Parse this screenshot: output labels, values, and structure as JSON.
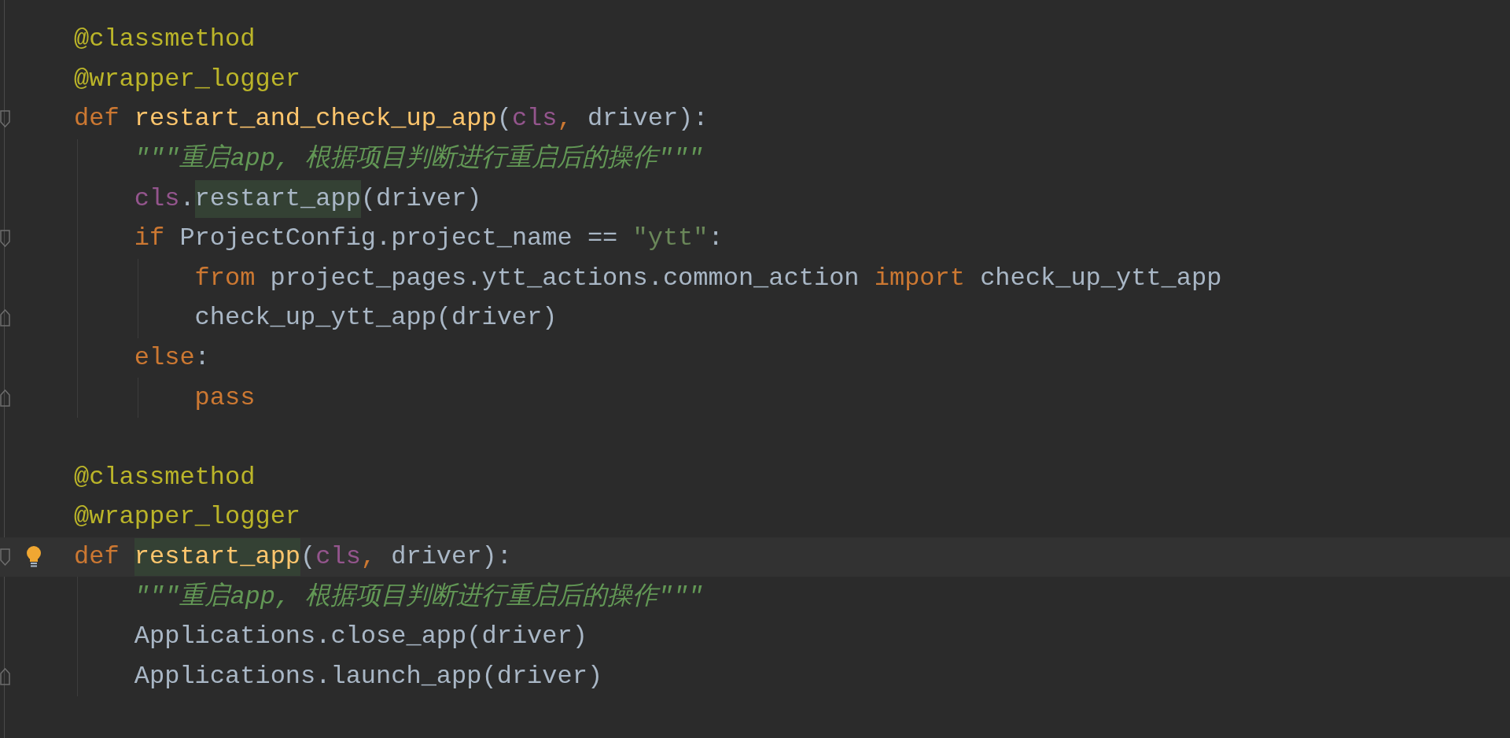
{
  "editor": {
    "lines": [
      {
        "current": false,
        "bulb": false,
        "fold_start": false,
        "fold_end": false,
        "tokens": [
          {
            "text": "@classmethod",
            "kind": "decorator",
            "highlighted": false
          }
        ]
      },
      {
        "current": false,
        "bulb": false,
        "fold_start": false,
        "fold_end": false,
        "tokens": [
          {
            "text": "@wrapper_logger",
            "kind": "decorator",
            "highlighted": false
          }
        ]
      },
      {
        "current": false,
        "bulb": false,
        "fold_start": true,
        "fold_end": false,
        "tokens": [
          {
            "text": "def",
            "kind": "keyword",
            "highlighted": false
          },
          {
            "text": "restart_and_check_up_app",
            "kind": "function",
            "highlighted": false
          },
          {
            "text": "(",
            "kind": "plain",
            "highlighted": false
          },
          {
            "text": "cls",
            "kind": "self",
            "highlighted": false
          },
          {
            "text": ",",
            "kind": "keyword",
            "highlighted": false
          },
          {
            "text": " driver):",
            "kind": "plain",
            "highlighted": false
          }
        ],
        "children": [
          {
            "current": false,
            "bulb": false,
            "fold_start": false,
            "fold_end": false,
            "tokens": [
              {
                "text": "\"\"\"重启app, 根据项目判断进行重启后的操作\"\"\"",
                "kind": "docstring",
                "highlighted": false
              }
            ]
          },
          {
            "current": false,
            "bulb": false,
            "fold_start": false,
            "fold_end": false,
            "tokens": [
              {
                "text": "cls",
                "kind": "self",
                "highlighted": false
              },
              {
                "text": ".",
                "kind": "plain",
                "highlighted": false
              },
              {
                "text": "restart_app",
                "kind": "plain",
                "highlighted": true
              },
              {
                "text": "(driver)",
                "kind": "plain",
                "highlighted": false
              }
            ]
          },
          {
            "current": false,
            "bulb": false,
            "fold_start": true,
            "fold_end": false,
            "tokens": [
              {
                "text": "if",
                "kind": "keyword",
                "highlighted": false
              },
              {
                "text": " ProjectConfig.project_name == ",
                "kind": "plain",
                "highlighted": false
              },
              {
                "text": "\"ytt\"",
                "kind": "string",
                "highlighted": false
              },
              {
                "text": ":",
                "kind": "plain",
                "highlighted": false
              }
            ],
            "children": [
              {
                "current": false,
                "bulb": false,
                "fold_start": false,
                "fold_end": false,
                "tokens": [
                  {
                    "text": "from",
                    "kind": "keyword",
                    "highlighted": false
                  },
                  {
                    "text": " project_pages.ytt_actions.common_action ",
                    "kind": "plain",
                    "highlighted": false
                  },
                  {
                    "text": "import",
                    "kind": "keyword",
                    "highlighted": false
                  },
                  {
                    "text": " check_up_ytt_app",
                    "kind": "plain",
                    "highlighted": false
                  }
                ]
              },
              {
                "current": false,
                "bulb": false,
                "fold_start": false,
                "fold_end": true,
                "tokens": [
                  {
                    "text": "check_up_ytt_app(driver)",
                    "kind": "plain",
                    "highlighted": false
                  }
                ]
              }
            ]
          },
          {
            "current": false,
            "bulb": false,
            "fold_start": false,
            "fold_end": false,
            "tokens": [
              {
                "text": "else",
                "kind": "keyword",
                "highlighted": false
              },
              {
                "text": ":",
                "kind": "plain",
                "highlighted": false
              }
            ],
            "children": [
              {
                "current": false,
                "bulb": false,
                "fold_start": false,
                "fold_end": true,
                "tokens": [
                  {
                    "text": "pass",
                    "kind": "keyword",
                    "highlighted": false
                  }
                ]
              }
            ]
          }
        ]
      },
      {
        "current": false,
        "bulb": false,
        "fold_start": false,
        "fold_end": false
      },
      {
        "current": false,
        "bulb": false,
        "fold_start": false,
        "fold_end": false,
        "tokens": [
          {
            "text": "@classmethod",
            "kind": "decorator",
            "highlighted": false
          }
        ]
      },
      {
        "current": false,
        "bulb": false,
        "fold_start": false,
        "fold_end": false,
        "tokens": [
          {
            "text": "@wrapper_logger",
            "kind": "decorator",
            "highlighted": false
          }
        ]
      },
      {
        "current": true,
        "bulb": true,
        "fold_start": true,
        "fold_end": false,
        "tokens": [
          {
            "text": "def",
            "kind": "keyword",
            "highlighted": false
          },
          {
            "text": "restart_app",
            "kind": "function",
            "highlighted": true
          },
          {
            "text": "(",
            "kind": "plain",
            "highlighted": false
          },
          {
            "text": "cls",
            "kind": "self",
            "highlighted": false
          },
          {
            "text": ",",
            "kind": "keyword",
            "highlighted": false
          },
          {
            "text": " driver):",
            "kind": "plain",
            "highlighted": false
          }
        ],
        "children": [
          {
            "current": false,
            "bulb": false,
            "fold_start": false,
            "fold_end": false,
            "tokens": [
              {
                "text": "\"\"\"重启app, 根据项目判断进行重启后的操作\"\"\"",
                "kind": "docstring",
                "highlighted": false
              }
            ]
          },
          {
            "current": false,
            "bulb": false,
            "fold_start": false,
            "fold_end": false,
            "tokens": [
              {
                "text": "Applications.close_app(driver)",
                "kind": "plain",
                "highlighted": false
              }
            ]
          },
          {
            "current": false,
            "bulb": false,
            "fold_start": false,
            "fold_end": true,
            "tokens": [
              {
                "text": "Applications.launch_app(driver)",
                "kind": "plain",
                "highlighted": false
              }
            ]
          }
        ]
      }
    ]
  }
}
